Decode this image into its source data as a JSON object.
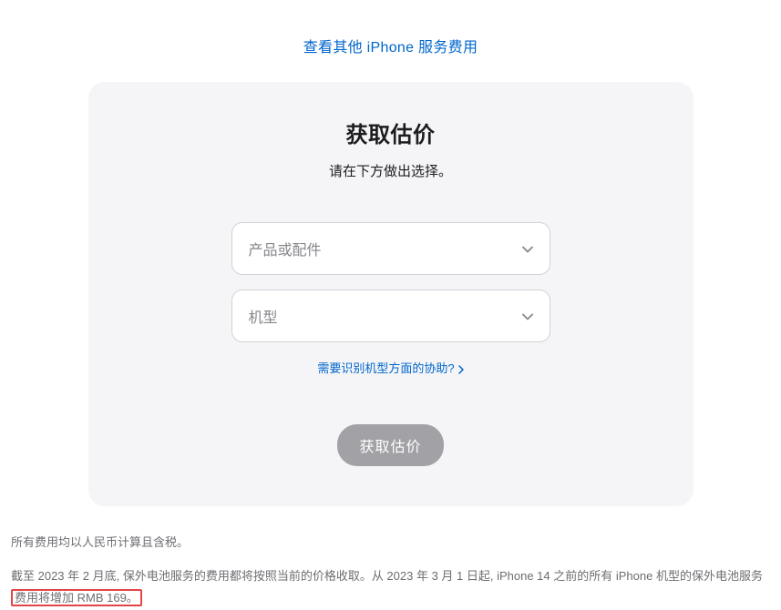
{
  "topLink": {
    "label": "查看其他 iPhone 服务费用"
  },
  "card": {
    "title": "获取估价",
    "subtitle": "请在下方做出选择。",
    "select_product_placeholder": "产品或配件",
    "select_model_placeholder": "机型",
    "help_link_label": "需要识别机型方面的协助?",
    "submit_label": "获取估价"
  },
  "footnotes": {
    "line1": "所有费用均以人民币计算且含税。",
    "line2_part1": "截至 2023 年 2 月底, 保外电池服务的费用都将按照当前的价格收取。从 2023 年 3 月 1 日起, iPhone 14 之前的所有 iPhone 机型的保外电池服务",
    "line2_highlight": "费用将增加 RMB 169。"
  }
}
